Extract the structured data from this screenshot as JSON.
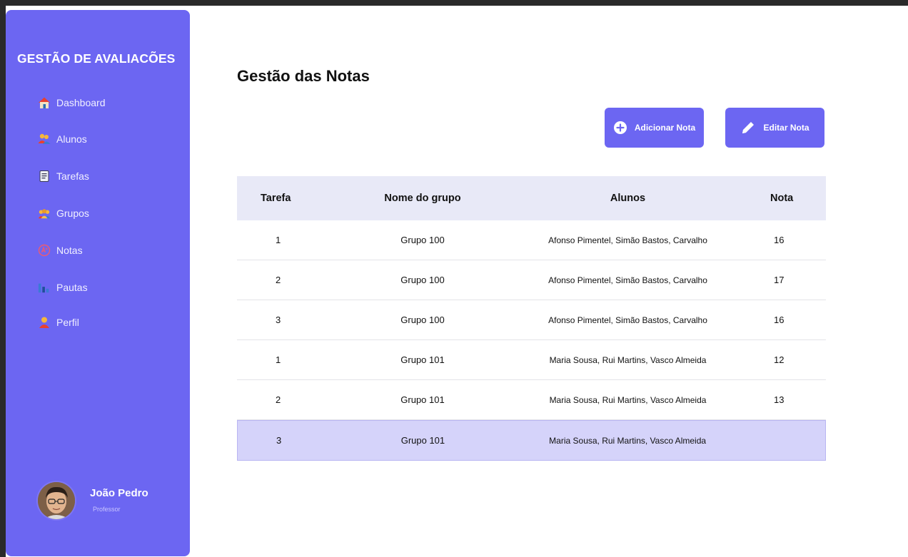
{
  "sidebar": {
    "brand": "GESTÃO DE AVALIACÕES",
    "items": [
      {
        "label": "Dashboard",
        "icon": "house-icon"
      },
      {
        "label": "Alunos",
        "icon": "students-icon"
      },
      {
        "label": "Tarefas",
        "icon": "clipboard-icon"
      },
      {
        "label": "Grupos",
        "icon": "group-icon"
      },
      {
        "label": "Notas",
        "icon": "grade-icon"
      },
      {
        "label": "Pautas",
        "icon": "bar-chart-icon"
      },
      {
        "label": "Perfil",
        "icon": "user-icon"
      }
    ],
    "profile": {
      "name": "João Pedro",
      "role": "Professor"
    }
  },
  "main": {
    "title": "Gestão das Notas",
    "buttons": {
      "add": "Adicionar Nota",
      "edit": "Editar Nota"
    },
    "table": {
      "headers": [
        "Tarefa",
        "Nome do grupo",
        "Alunos",
        "Nota"
      ],
      "rows": [
        {
          "tarefa": "1",
          "grupo": "Grupo 100",
          "alunos": "Afonso Pimentel, Simão Bastos, Carvalho",
          "nota": "16"
        },
        {
          "tarefa": "2",
          "grupo": "Grupo 100",
          "alunos": "Afonso Pimentel, Simão Bastos, Carvalho",
          "nota": "17"
        },
        {
          "tarefa": "3",
          "grupo": "Grupo 100",
          "alunos": "Afonso Pimentel, Simão Bastos, Carvalho",
          "nota": "16"
        },
        {
          "tarefa": "1",
          "grupo": "Grupo 101",
          "alunos": "Maria Sousa, Rui Martins, Vasco Almeida",
          "nota": "12"
        },
        {
          "tarefa": "2",
          "grupo": "Grupo 101",
          "alunos": "Maria Sousa, Rui Martins, Vasco Almeida",
          "nota": "13"
        },
        {
          "tarefa": "3",
          "grupo": "Grupo 101",
          "alunos": "Maria Sousa, Rui Martins, Vasco Almeida",
          "nota": ""
        }
      ]
    }
  },
  "colors": {
    "accent": "#6c66f2",
    "header_bg": "#e8e9f7",
    "selected_row": "#d5d3fa"
  }
}
